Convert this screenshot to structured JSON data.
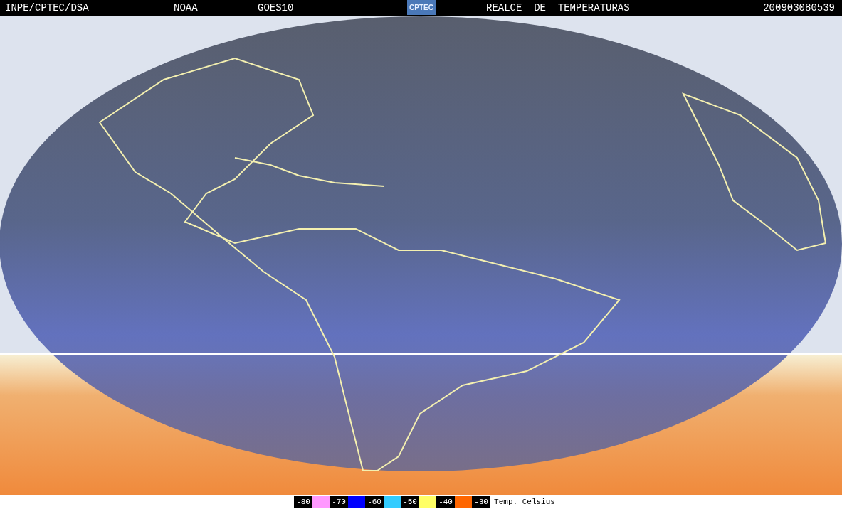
{
  "header": {
    "source": "INPE/CPTEC/DSA",
    "agency": "NOAA",
    "satellite": "GOES10",
    "logo": "CPTEC",
    "product": "REALCE  DE  TEMPERATURAS",
    "timestamp": "200903080539"
  },
  "legend": {
    "items": [
      {
        "label": "-80",
        "color": "#ff99ff"
      },
      {
        "label": "-70",
        "color": "#0000ff"
      },
      {
        "label": "-60",
        "color": "#33ccff"
      },
      {
        "label": "-50",
        "color": "#ffff66"
      },
      {
        "label": "-40",
        "color": "#ff6600"
      },
      {
        "label": "-30"
      }
    ],
    "caption": "Temp. Celsius"
  }
}
